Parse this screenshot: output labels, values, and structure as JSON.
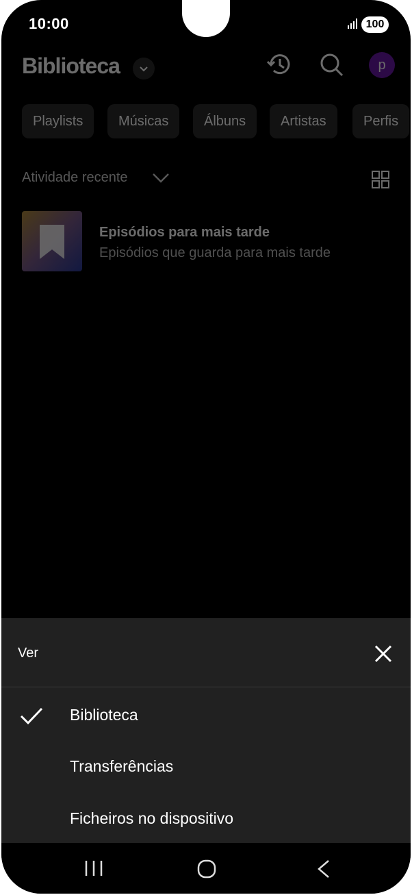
{
  "status_bar": {
    "time": "10:00",
    "battery": "100"
  },
  "header": {
    "title": "Biblioteca",
    "avatar_letter": "p"
  },
  "filters": [
    "Playlists",
    "Músicas",
    "Álbuns",
    "Artistas",
    "Perfis"
  ],
  "recent": {
    "label": "Atividade recente",
    "items": [
      {
        "title": "Episódios para mais tarde",
        "subtitle": "Episódios que guarda para mais tarde"
      }
    ]
  },
  "sheet": {
    "title": "Ver",
    "options": [
      {
        "label": "Biblioteca",
        "selected": true
      },
      {
        "label": "Transferências",
        "selected": false
      },
      {
        "label": "Ficheiros no dispositivo",
        "selected": false
      }
    ]
  },
  "colors": {
    "sheet_bg": "#212121",
    "avatar": "#6a1aa8"
  }
}
